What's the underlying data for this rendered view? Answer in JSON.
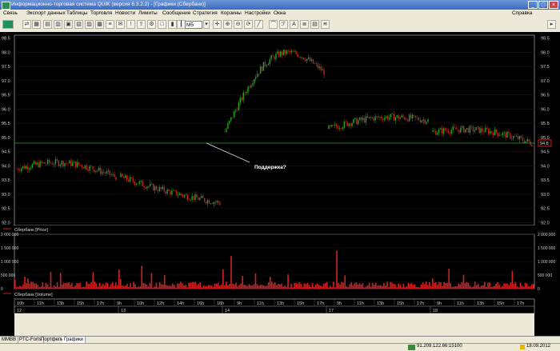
{
  "window": {
    "title": "Информационно-торговая система QUIK (версия 6.3.2.2) - [Графики (Сбербанк)]",
    "help_label": "Справка"
  },
  "menu": [
    "Связь",
    "Экспорт данных",
    "Таблицы",
    "Торговля",
    "Новости",
    "Лимиты",
    "Сообщение",
    "Стратегия",
    "Корзины",
    "Настройки",
    "Окна"
  ],
  "toolbar": {
    "interval_value": "M5"
  },
  "chart_data": {
    "type": "candlestick",
    "price_panel": {
      "legend": "Сбербанк [Price]",
      "y_ticks": [
        "98.5",
        "98.0",
        "97.5",
        "97.0",
        "96.5",
        "96.0",
        "95.5",
        "95.0",
        "94.5",
        "94.0",
        "93.5",
        "93.0",
        "92.5",
        "92.0"
      ],
      "ylim": [
        91.9,
        98.6
      ],
      "support_level": 94.8,
      "current_price": "94.8",
      "annotation": "Поддержка?",
      "days": [
        {
          "label": "12",
          "start": 93.9,
          "end": 93.6,
          "high": 94.5,
          "low": 93.5
        },
        {
          "label": "13",
          "start": 93.6,
          "end": 92.7,
          "high": 94.1,
          "low": 92.4
        },
        {
          "label": "14",
          "start": 95.2,
          "end": 97.3,
          "high": 98.1,
          "low": 94.6
        },
        {
          "label": "17",
          "start": 95.3,
          "end": 95.6,
          "high": 96.1,
          "low": 94.8
        },
        {
          "label": "18",
          "start": 95.2,
          "end": 94.8,
          "high": 96.6,
          "low": 94.6
        }
      ]
    },
    "volume_panel": {
      "legend": "Сбербанк [Volume]",
      "y_ticks_left": [
        "2 000 000",
        "1 500 000",
        "1 000 000",
        "500 000",
        "0"
      ],
      "y_ticks_right": [
        "2 000 000",
        "1 500 000",
        "1 000 000",
        "500 000",
        "0"
      ],
      "ylim": [
        0,
        2000000
      ]
    },
    "x_hours": [
      "10h",
      "11h",
      "13h",
      "15h",
      "17h",
      "9h",
      "10h",
      "12h",
      "14h",
      "16h",
      "18h",
      "9h",
      "11h",
      "13h",
      "15h",
      "17h",
      "9h",
      "11h",
      "13h",
      "15h",
      "17h",
      "9h",
      "11h",
      "13h",
      "15h",
      "17h"
    ],
    "x_dates": [
      "12",
      "13",
      "14",
      "17",
      "18"
    ]
  },
  "tabs": [
    "MMBB",
    "PTC-Forts",
    "Портфель",
    "Графики"
  ],
  "status": {
    "connection": "91.209.122.66:15100",
    "date": "18.09.2012"
  },
  "colors": {
    "bull": "#22aa22",
    "bear": "#cc2222",
    "support": "#22aa22",
    "volume": "#cc2222"
  }
}
